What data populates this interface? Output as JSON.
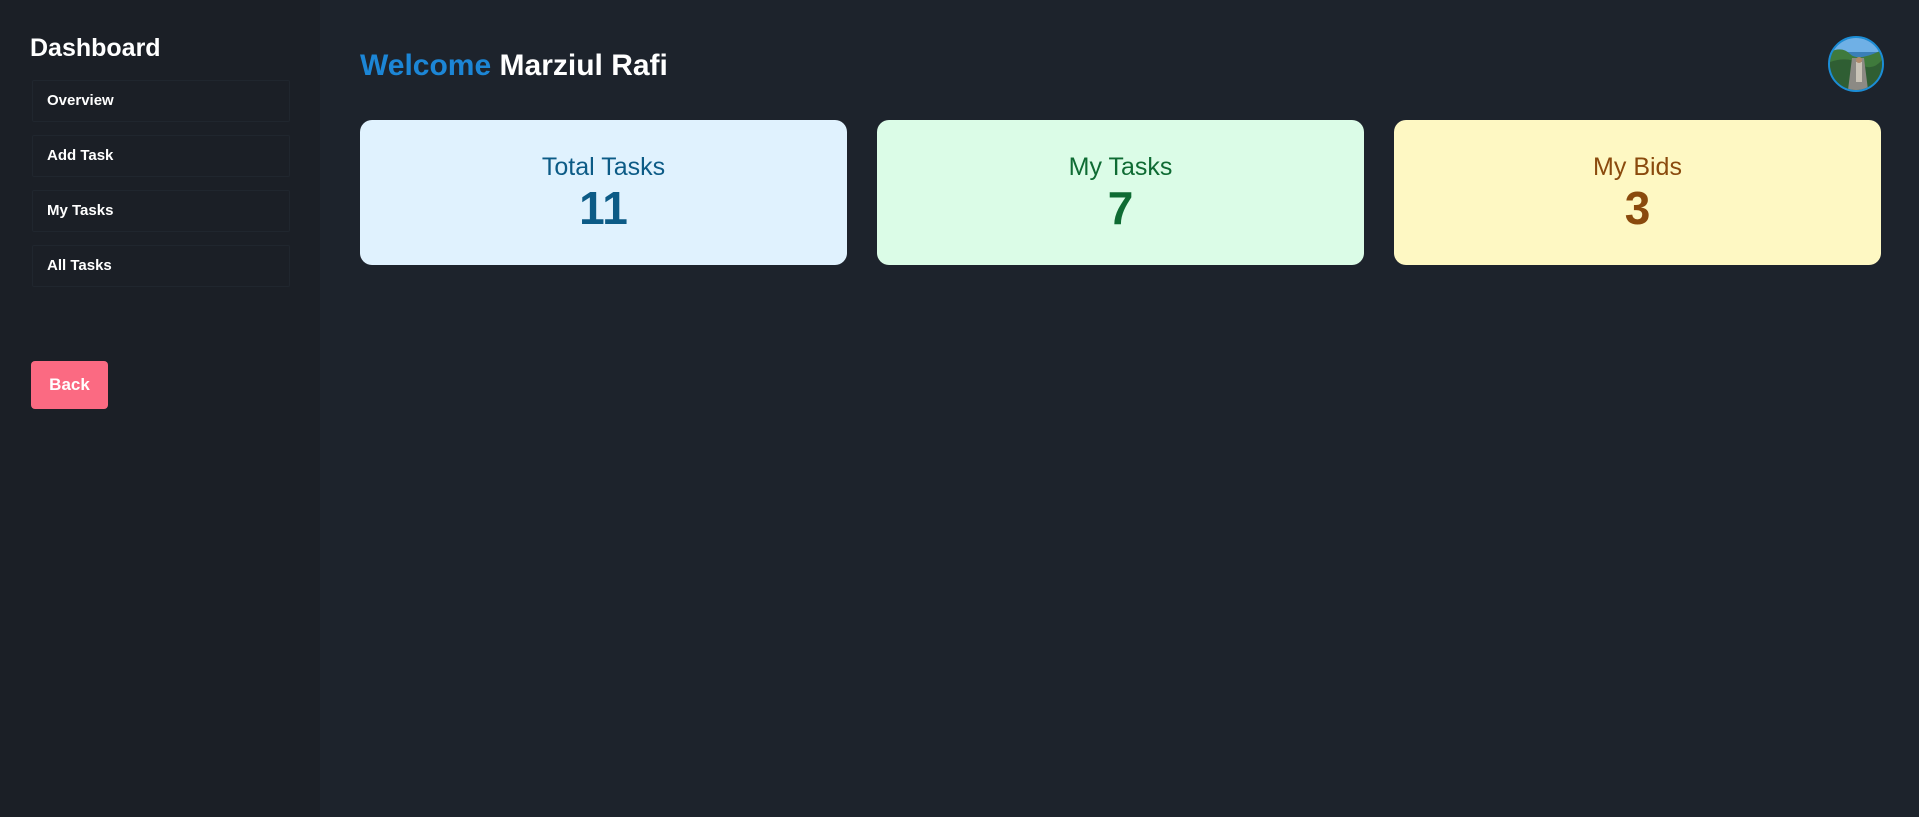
{
  "sidebar": {
    "title": "Dashboard",
    "items": [
      {
        "label": "Overview"
      },
      {
        "label": "Add Task"
      },
      {
        "label": "My Tasks"
      },
      {
        "label": "All Tasks"
      }
    ],
    "back_label": "Back"
  },
  "header": {
    "welcome_word": "Welcome",
    "user_name": "Marziul Rafi"
  },
  "stats": [
    {
      "label": "Total Tasks",
      "value": "11"
    },
    {
      "label": "My Tasks",
      "value": "7"
    },
    {
      "label": "My Bids",
      "value": "3"
    }
  ],
  "colors": {
    "accent": "#1c86d6",
    "back_button": "#fb6a82",
    "total_card_bg": "#e0f2fe",
    "my_tasks_card_bg": "#dbfce7",
    "my_bids_card_bg": "#fef8c3"
  }
}
